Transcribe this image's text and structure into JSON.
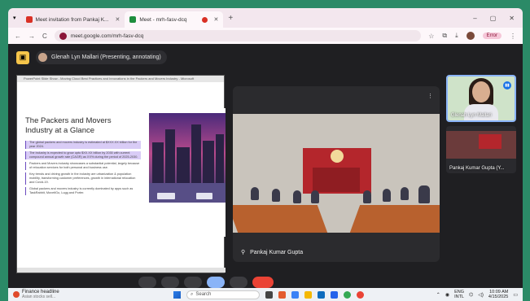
{
  "browser": {
    "tabs": [
      {
        "label": "Meet invitation from Pankaj K...",
        "active": false,
        "icon": "gmail-icon"
      },
      {
        "label": "Meet - mrh-fasv-dcq",
        "active": true,
        "icon": "meet-icon"
      }
    ],
    "new_tab": "+",
    "window_controls": {
      "minimize": "–",
      "maximize": "▢",
      "close": "✕"
    },
    "back": "←",
    "forward": "→",
    "reload": "C",
    "url": "meet.google.com/mrh-fasv-dcq",
    "error_label": "Error"
  },
  "meet": {
    "presenter_label": "Glenah Lyn Mallari (Presenting, annotating)",
    "share_window_title": "PowerPoint Slide Show - Moving Cloud Best Practices and Innovations in the Packers and Movers Industry - Microsoft",
    "slide": {
      "title": "The Packers and Movers Industry at a Glance",
      "bullets": [
        "The global packers and movers industry is estimated at $XXX.XX billion for the year 2024.",
        "The industry is expected to grow upto $XX.XX billion by 2030 with current compound annual growth rate (CAGR) as XX% during the period of 2025-2030.",
        "Packers and Movers industry showcases a substantial potential, largely because of relocation services for both personal and business use.",
        "Key trends and driving growth in the industry are urbanization & population mobility, transforming customer preferences, growth in international relocation and Covid-19.",
        "Global packers and movers industry is currently dominated by apps such as TaskRabbit, MoveitGo, Lugg and Porter."
      ]
    },
    "room": {
      "name": "Pankaj Kumar Gupta"
    },
    "participants": [
      {
        "name": "Glenah Lyn Mallari"
      },
      {
        "name": "Pankaj Kumar Gupta (Y..."
      }
    ]
  },
  "taskbar": {
    "news_title": "Finance headline",
    "news_sub": "Asian stocks sell...",
    "search_placeholder": "Search",
    "lang": "ENG",
    "lang_sub": "INTL",
    "time": "10:09 AM",
    "date": "4/15/2025"
  },
  "colors": {
    "meet_bg": "#1f1f22",
    "accent": "#8ab4f8",
    "end_call": "#ea4335",
    "desktop": "#2b8a67"
  }
}
